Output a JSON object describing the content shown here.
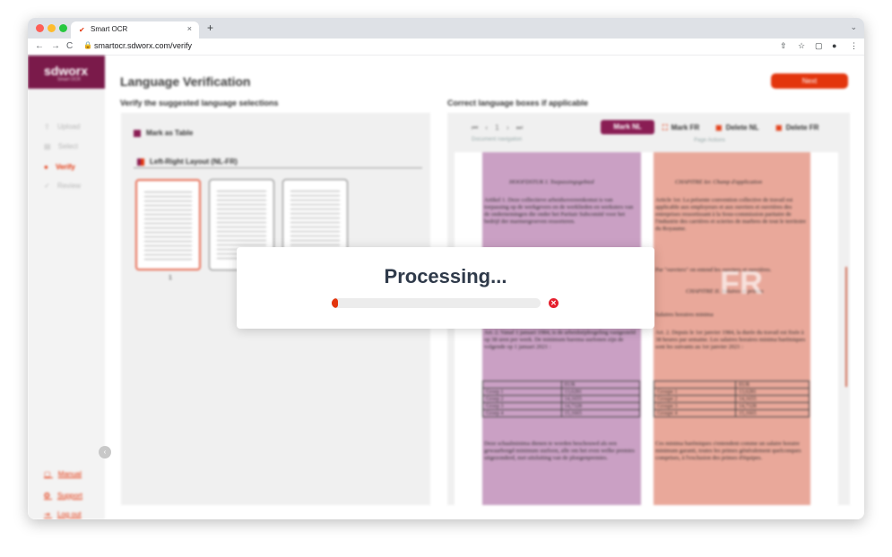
{
  "browser": {
    "tab_title": "Smart OCR",
    "tab_close": "×",
    "new_tab": "+",
    "url": "smartocr.sdworx.com/verify",
    "lock": "🔒",
    "nav": [
      "←",
      "→",
      "C"
    ],
    "toolbar_icons": [
      "⇧",
      "☆",
      "▢",
      "●",
      "⋮"
    ],
    "tab_menu": "⌄"
  },
  "sidebar": {
    "logo": "sdworx",
    "logo_sub": "Smart OCR",
    "items": [
      {
        "icon": "⇧",
        "label": "Upload"
      },
      {
        "icon": "▤",
        "label": "Select"
      },
      {
        "icon": "●",
        "label": "Verify"
      },
      {
        "icon": "✓",
        "label": "Review"
      }
    ],
    "links": [
      {
        "icon": "▢",
        "label": "Manual"
      },
      {
        "icon": "✪",
        "label": "Support"
      },
      {
        "icon": "⇥",
        "label": "Log out"
      }
    ],
    "collapse": "‹"
  },
  "header": {
    "title": "Language Verification",
    "next_label": "Next"
  },
  "left": {
    "section_title": "Verify the suggested language selections",
    "mark_table": "Mark as Table",
    "layout_label": "Left-Right Layout (NL-FR)",
    "selected_page": "1"
  },
  "right": {
    "section_title": "Correct language boxes if applicable",
    "doc_nav": "⏮ ‹ 1 › ⏭",
    "doc_nav_caption": "Document navigation",
    "actions": {
      "mark_nl": "Mark NL",
      "mark_fr": "Mark FR",
      "delete_nl": "Delete NL",
      "delete_fr": "Delete FR",
      "caption": "Page Actions"
    },
    "watermark": "FR",
    "nl_text": {
      "heading": "HOOFDSTUK I. Toepassingsgebied",
      "art1": "Artikel 1. Deze collectieve arbeidsovereenkomst is van toepassing op de werkgevers en de werklieden en werksters van de ondernemingen die onder het Paritair Subcomité voor het bedrijf der marmergroeven ressorteren.",
      "art2": "Art. 2. Vanaf 1 januari 1984, is de arbeidstijdregeling vastgesteld op 38 uren per week. De minimum barema uurlonen zijn de volgende op 1 januari 2021 :",
      "footer": "Deze schaalminima dienen te worden beschouwd als een gewaarborgd minimum uurloon, alle om het even welke premies uitgezonderd, met uitsluiting van de ploegenpremies."
    },
    "fr_text": {
      "heading": "CHAPITRE Ier. Champ d'application",
      "art1": "Article 1er. La présente convention collective de travail est applicable aux employeurs et aux ouvriers et ouvrières des entreprises ressortissant à la Sous-commission paritaire de l'industrie des carrières et scieries de marbres de tout le territoire du Royaume.",
      "mid": "Par \"ouvriers\" on entend les ouvriers et ouvrières.",
      "chap2": "CHAPITRE II. Salaires et primes",
      "salaires": "Salaires horaires minima",
      "art2": "Art. 2. Depuis le 1er janvier 1984, la durée du travail est fixée à 38 heures par semaine. Les salaires horaires minima barémiques sont les suivants au 1er janvier 2021 :",
      "footer": "Ces minima barémiques s'entendent comme un salaire horaire minimum garanti, toutes les primes généralement quelconques comprises, à l'exclusion des primes d'équipes."
    },
    "nl_table": {
      "header": "EUR",
      "rows": [
        [
          "Groep 1",
          "13,6281"
        ],
        [
          "Groep 2",
          "14,1655"
        ],
        [
          "Groep 3",
          "14,7328"
        ],
        [
          "Groep 4",
          "15,1665"
        ]
      ]
    },
    "fr_table": {
      "header": "EUR",
      "rows": [
        [
          "Groupe 1",
          "13,6281"
        ],
        [
          "Groupe 2",
          "14,1655"
        ],
        [
          "Groupe 3",
          "14,7328"
        ],
        [
          "Groupe 4",
          "15,1665"
        ]
      ]
    }
  },
  "modal": {
    "title": "Processing...",
    "progress": 0.03,
    "cancel": "✕"
  },
  "colors": {
    "brand": "#7a1a4a",
    "accent": "#e3350d",
    "nl_box": "#caa0c4",
    "fr_box": "#e9a89a"
  }
}
